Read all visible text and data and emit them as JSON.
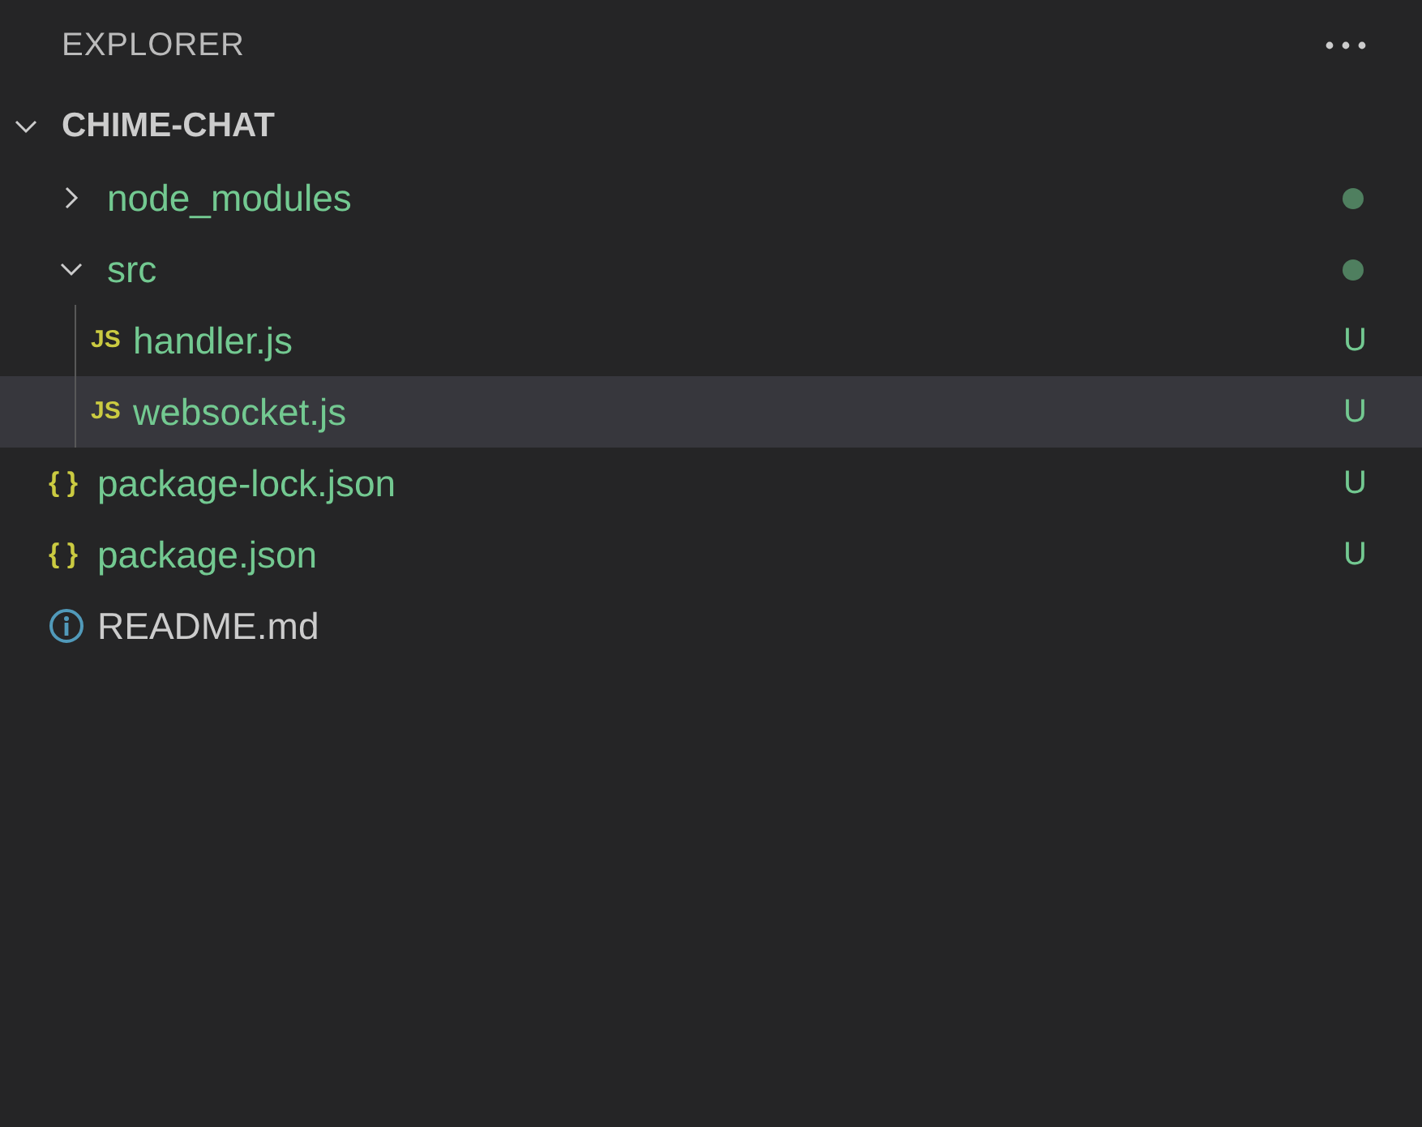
{
  "title": "EXPLORER",
  "folder": {
    "name": "CHIME-CHAT",
    "expanded": true,
    "children": [
      {
        "kind": "folder",
        "name": "node_modules",
        "expanded": false,
        "selected": false,
        "untracked": true,
        "has_changes": true
      },
      {
        "kind": "folder",
        "name": "src",
        "expanded": true,
        "selected": false,
        "untracked": true,
        "has_changes": true,
        "children": [
          {
            "kind": "js_file",
            "name": "handler.js",
            "icon_text": "JS",
            "selected": false,
            "untracked": true,
            "badge": "U"
          },
          {
            "kind": "js_file",
            "name": "websocket.js",
            "icon_text": "JS",
            "selected": true,
            "untracked": true,
            "badge": "U"
          }
        ]
      },
      {
        "kind": "json_file",
        "name": "package-lock.json",
        "icon_text": "{ }",
        "selected": false,
        "untracked": true,
        "badge": "U"
      },
      {
        "kind": "json_file",
        "name": "package.json",
        "icon_text": "{ }",
        "selected": false,
        "untracked": true,
        "badge": "U"
      },
      {
        "kind": "info_file",
        "name": "README.md",
        "selected": false,
        "untracked": false
      }
    ]
  }
}
